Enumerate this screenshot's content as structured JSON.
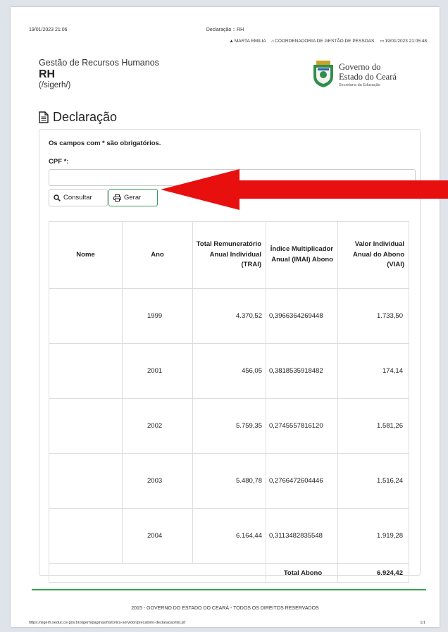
{
  "print_header": {
    "date": "19/01/2023 21:06",
    "title": "Declaração :: RH",
    "user": "MARTA EMILIA",
    "department": "COORDENADORIA DE GESTÃO DE PESSOAS",
    "datetime": "19/01/2023 21:05:48"
  },
  "app": {
    "name": "Gestão de Recursos Humanos",
    "short": "RH",
    "path": "(/sigerh/)"
  },
  "gov_logo": {
    "line1": "Governo do",
    "line2": "Estado do Ceará",
    "line3": "Secretaria da Educação"
  },
  "page_title": "Declaração",
  "form": {
    "required_note": "Os campos com * são obrigatórios.",
    "cpf_label": "CPF *:",
    "cpf_value": "",
    "consultar_label": "Consultar",
    "gerar_label": "Gerar"
  },
  "table": {
    "headers": {
      "nome": "Nome",
      "ano": "Ano",
      "trai": "Total Remuneratório Anual Individual (TRAI)",
      "imai": "Índice Multiplicador Anual (IMAI) Abono",
      "viai": "Valor Individual Anual do Abono (VIAI)"
    },
    "rows": [
      {
        "nome": "",
        "ano": "1999",
        "trai": "4.370,52",
        "imai": "0,3966364269448",
        "viai": "1.733,50"
      },
      {
        "nome": "",
        "ano": "2001",
        "trai": "456,05",
        "imai": "0,3818535918482",
        "viai": "174,14"
      },
      {
        "nome": "",
        "ano": "2002",
        "trai": "5.759,35",
        "imai": "0,2745557816120",
        "viai": "1.581,26"
      },
      {
        "nome": "",
        "ano": "2003",
        "trai": "5.480,78",
        "imai": "0,2766472604446",
        "viai": "1.516,24"
      },
      {
        "nome": "",
        "ano": "2004",
        "trai": "6.164,44",
        "imai": "0,3113482835548",
        "viai": "1.919,28"
      }
    ],
    "total_label": "Total Abono",
    "total_value": "6.924,42"
  },
  "footer": {
    "text": "2015 - GOVERNO DO ESTADO DO CEARÁ - TODOS OS DIREITOS RESERVADOS",
    "url": "https://sigerh.seduc.ce.gov.br/sigerh/paginas/historico-servidor/precatorio-declaracao/list.jsf",
    "page": "1/1"
  },
  "colors": {
    "accent_green": "#3aa34a",
    "arrow_red": "#e8100f"
  }
}
